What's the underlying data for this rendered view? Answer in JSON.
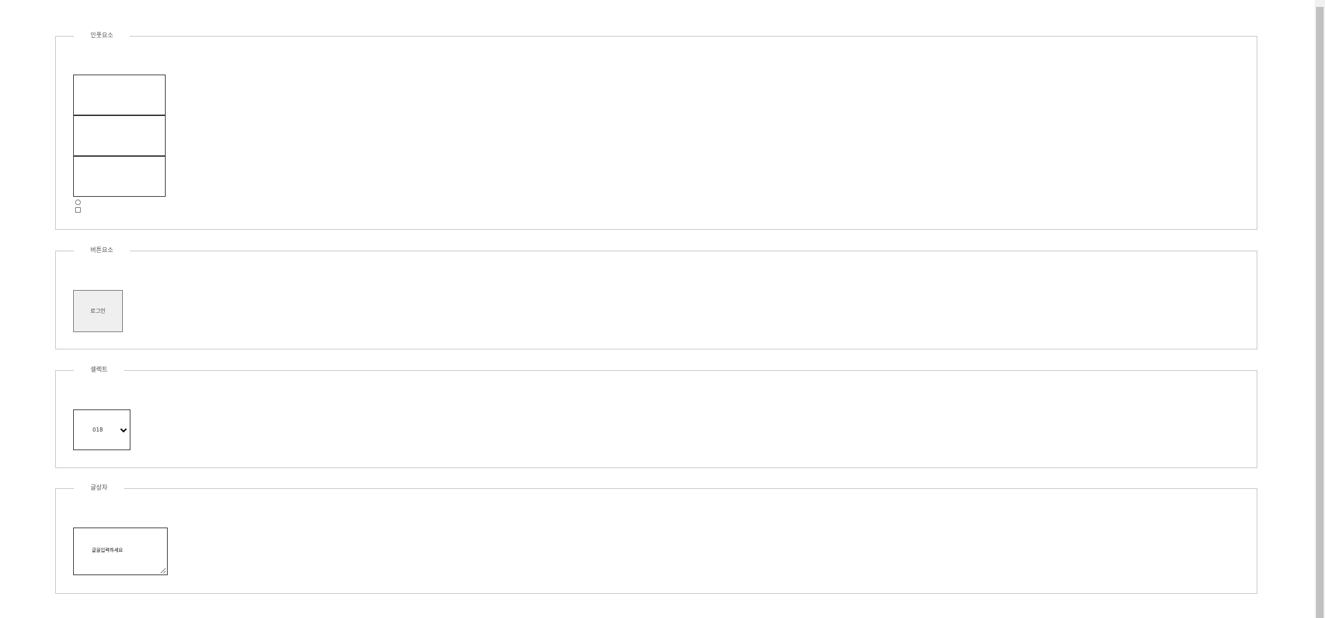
{
  "sections": {
    "input": {
      "legend": "인풋요소"
    },
    "button": {
      "legend": "버튼요소",
      "button_label": "로그인"
    },
    "select": {
      "legend": "셀렉트",
      "selected_value": "018"
    },
    "textarea": {
      "legend": "글상자",
      "text": "글을입력하세요"
    }
  },
  "icons": {
    "select_arrow": "chevron-down-icon",
    "textarea_resize": "resize-grip-icon"
  },
  "colors": {
    "fieldset_border": "#c6c6c6",
    "button_bg": "#efefef",
    "scrollbar_thumb": "#c1c1c1"
  }
}
